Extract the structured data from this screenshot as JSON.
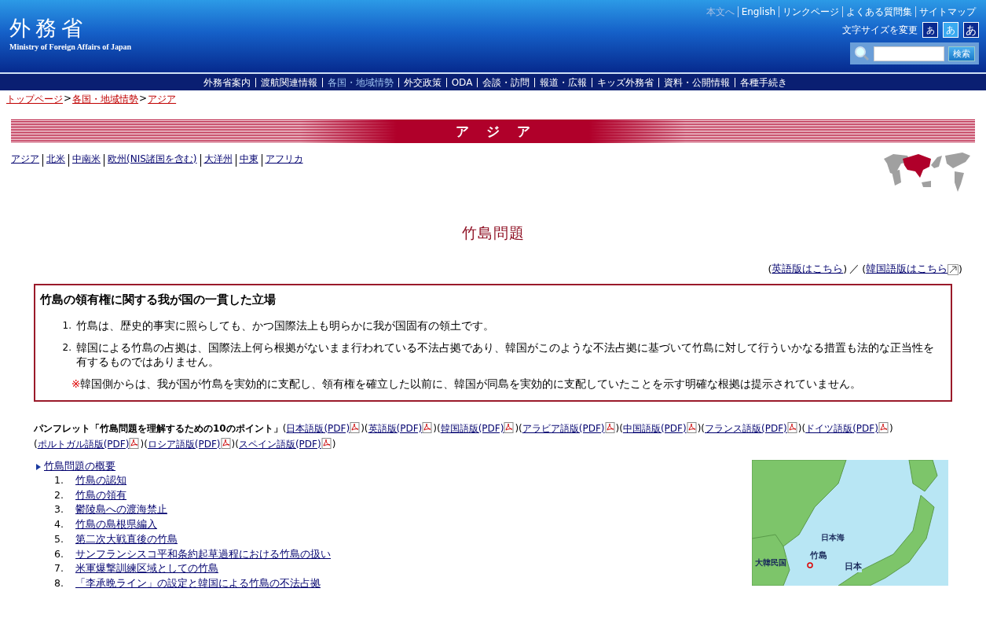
{
  "header": {
    "logo_jp": "外務省",
    "logo_en": "Ministry of Foreign Affairs of Japan",
    "utility_links": [
      {
        "label": "本文へ",
        "disabled": true
      },
      {
        "label": "English",
        "disabled": false
      },
      {
        "label": "リンクページ",
        "disabled": false
      },
      {
        "label": "よくある質問集",
        "disabled": false
      },
      {
        "label": "サイトマップ",
        "disabled": false
      }
    ],
    "font_size": {
      "label": "文字サイズを変更",
      "options": [
        {
          "label": "あ",
          "kind": "small",
          "selected": false
        },
        {
          "label": "あ",
          "kind": "medium",
          "selected": true
        },
        {
          "label": "あ",
          "kind": "large",
          "selected": false
        }
      ]
    },
    "search": {
      "button": "検索"
    }
  },
  "nav": [
    {
      "label": "外務省案内",
      "selected": false
    },
    {
      "label": "渡航関連情報",
      "selected": false
    },
    {
      "label": "各国・地域情勢",
      "selected": true
    },
    {
      "label": "外交政策",
      "selected": false
    },
    {
      "label": "ODA",
      "selected": false
    },
    {
      "label": "会談・訪問",
      "selected": false
    },
    {
      "label": "報道・広報",
      "selected": false
    },
    {
      "label": "キッズ外務省",
      "selected": false
    },
    {
      "label": "資料・公開情報",
      "selected": false
    },
    {
      "label": "各種手続き",
      "selected": false
    }
  ],
  "breadcrumb": [
    {
      "label": "トップページ",
      "separator": ">"
    },
    {
      "label": "各国・地域情勢",
      "separator": ">"
    },
    {
      "label": "アジア"
    }
  ],
  "banner": {
    "title": "アジア"
  },
  "regions": [
    "アジア",
    "北米",
    "中南米",
    "欧州(NIS諸国を含む)",
    "大洋州",
    "中東",
    "アフリカ"
  ],
  "page_title": "竹島問題",
  "language_links": {
    "items": [
      {
        "open": "(",
        "label": "英語版はこちら",
        "close": ")",
        "external": false
      },
      {
        "open": "(",
        "label": "韓国語版はこちら",
        "close": ")",
        "external": true
      }
    ],
    "divider": "／"
  },
  "position_box": {
    "heading": "竹島の領有権に関する我が国の一貫した立場",
    "items": [
      {
        "number": "1.",
        "text": "竹島は、歴史的事実に照らしても、かつ国際法上も明らかに我が国固有の領土です。"
      },
      {
        "number": "2.",
        "text": "韓国による竹島の占拠は、国際法上何ら根拠がないまま行われている不法占拠であり、韓国がこのような不法占拠に基づいて竹島に対して行ういかなる措置も法的な正当性を有するものではありません。"
      }
    ],
    "note": {
      "mark": "※",
      "text": "韓国側からは、我が国が竹島を実効的に支配し、領有権を確立した以前に、韓国が同島を実効的に支配していたことを示す明確な根拠は提示されていません。"
    }
  },
  "pamphlet": {
    "title": "パンフレット「竹島問題を理解するための10のポイント」",
    "links": [
      {
        "open": "(",
        "label": "日本語版(PDF)",
        "close": ")"
      },
      {
        "open": "(",
        "label": "英語版(PDF)",
        "close": ")"
      },
      {
        "open": "(",
        "label": "韓国語版(PDF)",
        "close": ")"
      },
      {
        "open": "(",
        "label": "アラビア語版(PDF)",
        "close": ")"
      },
      {
        "open": "(",
        "label": "中国語版(PDF)",
        "close": ")"
      },
      {
        "open": "(",
        "label": "フランス語版(PDF)",
        "close": ")"
      },
      {
        "open": "(",
        "label": "ドイツ語版(PDF)",
        "close": ")"
      },
      {
        "open": "(",
        "label": "ポルトガル語版(PDF)",
        "close": ")"
      },
      {
        "open": "(",
        "label": "ロシア語版(PDF)",
        "close": ")"
      },
      {
        "open": "(",
        "label": "スペイン語版(PDF)",
        "close": ")"
      }
    ]
  },
  "overview": {
    "heading": "竹島問題の概要",
    "items": [
      {
        "number": "1.",
        "label": "竹島の認知"
      },
      {
        "number": "2.",
        "label": "竹島の領有"
      },
      {
        "number": "3.",
        "label": "鬱陵島への渡海禁止"
      },
      {
        "number": "4.",
        "label": "竹島の島根県編入"
      },
      {
        "number": "5.",
        "label": "第二次大戦直後の竹島"
      },
      {
        "number": "6.",
        "label": "サンフランシスコ平和条約起草過程における竹島の扱い"
      },
      {
        "number": "7.",
        "label": "米軍爆撃訓練区域としての竹島"
      },
      {
        "number": "8.",
        "label": "「李承晩ライン」の設定と韓国による竹島の不法占拠"
      }
    ]
  },
  "map": {
    "labels": [
      {
        "text": "日本海",
        "kind": "sea"
      },
      {
        "text": "竹島",
        "kind": "island"
      },
      {
        "text": "大韓民国",
        "kind": "country-west"
      },
      {
        "text": "日本",
        "kind": "country-east"
      }
    ]
  }
}
